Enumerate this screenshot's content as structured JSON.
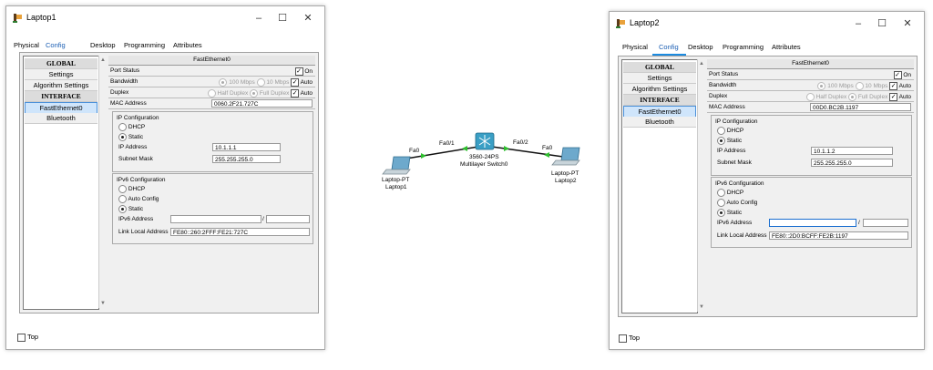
{
  "laptop1": {
    "title": "Laptop1",
    "tabs": [
      "Physical",
      "Config",
      "Desktop",
      "Programming",
      "Attributes"
    ],
    "active_tab": "Config",
    "left_list": {
      "global_header": "GLOBAL",
      "settings": "Settings",
      "algorithm_settings": "Algorithm Settings",
      "interface_header": "INTERFACE",
      "fastethernet": "FastEthernet0",
      "bluetooth": "Bluetooth"
    },
    "panel_title": "FastEthernet0",
    "port_status_label": "Port Status",
    "port_on_label": "On",
    "bandwidth_label": "Bandwidth",
    "bw_100": "100 Mbps",
    "bw_10": "10 Mbps",
    "bw_auto": "Auto",
    "duplex_label": "Duplex",
    "half_duplex": "Half Duplex",
    "full_duplex": "Full Duplex",
    "duplex_auto": "Auto",
    "mac_label": "MAC Address",
    "mac_value": "0060.2F21.727C",
    "ip_config_title": "IP Configuration",
    "dhcp": "DHCP",
    "static": "Static",
    "ip_label": "IP Address",
    "ip_value": "10.1.1.1",
    "mask_label": "Subnet Mask",
    "mask_value": "255.255.255.0",
    "ipv6_title": "IPv6 Configuration",
    "v6_dhcp": "DHCP",
    "v6_auto": "Auto Config",
    "v6_static": "Static",
    "ipv6_label": "IPv6 Address",
    "ipv6_value": "",
    "ipv6_slash": "/",
    "ll_label": "Link Local Address",
    "ll_value": "FE80::260:2FFF:FE21:727C",
    "top_label": "Top"
  },
  "laptop2": {
    "title": "Laptop2",
    "tabs": [
      "Physical",
      "Config",
      "Desktop",
      "Programming",
      "Attributes"
    ],
    "active_tab": "Config",
    "left_list": {
      "global_header": "GLOBAL",
      "settings": "Settings",
      "algorithm_settings": "Algorithm Settings",
      "interface_header": "INTERFACE",
      "fastethernet": "FastEthernet0",
      "bluetooth": "Bluetooth"
    },
    "panel_title": "FastEthernet0",
    "port_status_label": "Port Status",
    "port_on_label": "On",
    "bandwidth_label": "Bandwidth",
    "bw_100": "100 Mbps",
    "bw_10": "10 Mbps",
    "bw_auto": "Auto",
    "duplex_label": "Duplex",
    "half_duplex": "Half Duplex",
    "full_duplex": "Full Duplex",
    "duplex_auto": "Auto",
    "mac_label": "MAC Address",
    "mac_value": "00D0.BC2B.1197",
    "ip_config_title": "IP Configuration",
    "dhcp": "DHCP",
    "static": "Static",
    "ip_label": "IP Address",
    "ip_value": "10.1.1.2",
    "mask_label": "Subnet Mask",
    "mask_value": "255.255.255.0",
    "ipv6_title": "IPv6 Configuration",
    "v6_dhcp": "DHCP",
    "v6_auto": "Auto Config",
    "v6_static": "Static",
    "ipv6_label": "IPv6 Address",
    "ipv6_value": "",
    "ipv6_slash": "/",
    "ll_label": "Link Local Address",
    "ll_value": "FE80::2D0:BCFF:FE2B:1197",
    "top_label": "Top"
  },
  "topology": {
    "laptop1_type": "Laptop-PT",
    "laptop1_name": "Laptop1",
    "laptop2_type": "Laptop-PT",
    "laptop2_name": "Laptop2",
    "switch_model": "3560-24PS",
    "switch_name": "Multilayer Switch0",
    "link1_left": "Fa0",
    "link1_right": "Fa0/1",
    "link2_left": "Fa0/2",
    "link2_right": "Fa0",
    "link_color": "#111111",
    "port_color": "#2fbf2f",
    "switch_color": "#3a9fc5"
  },
  "window_controls": {
    "minimize": "–",
    "maximize": "☐",
    "close": "✕"
  }
}
